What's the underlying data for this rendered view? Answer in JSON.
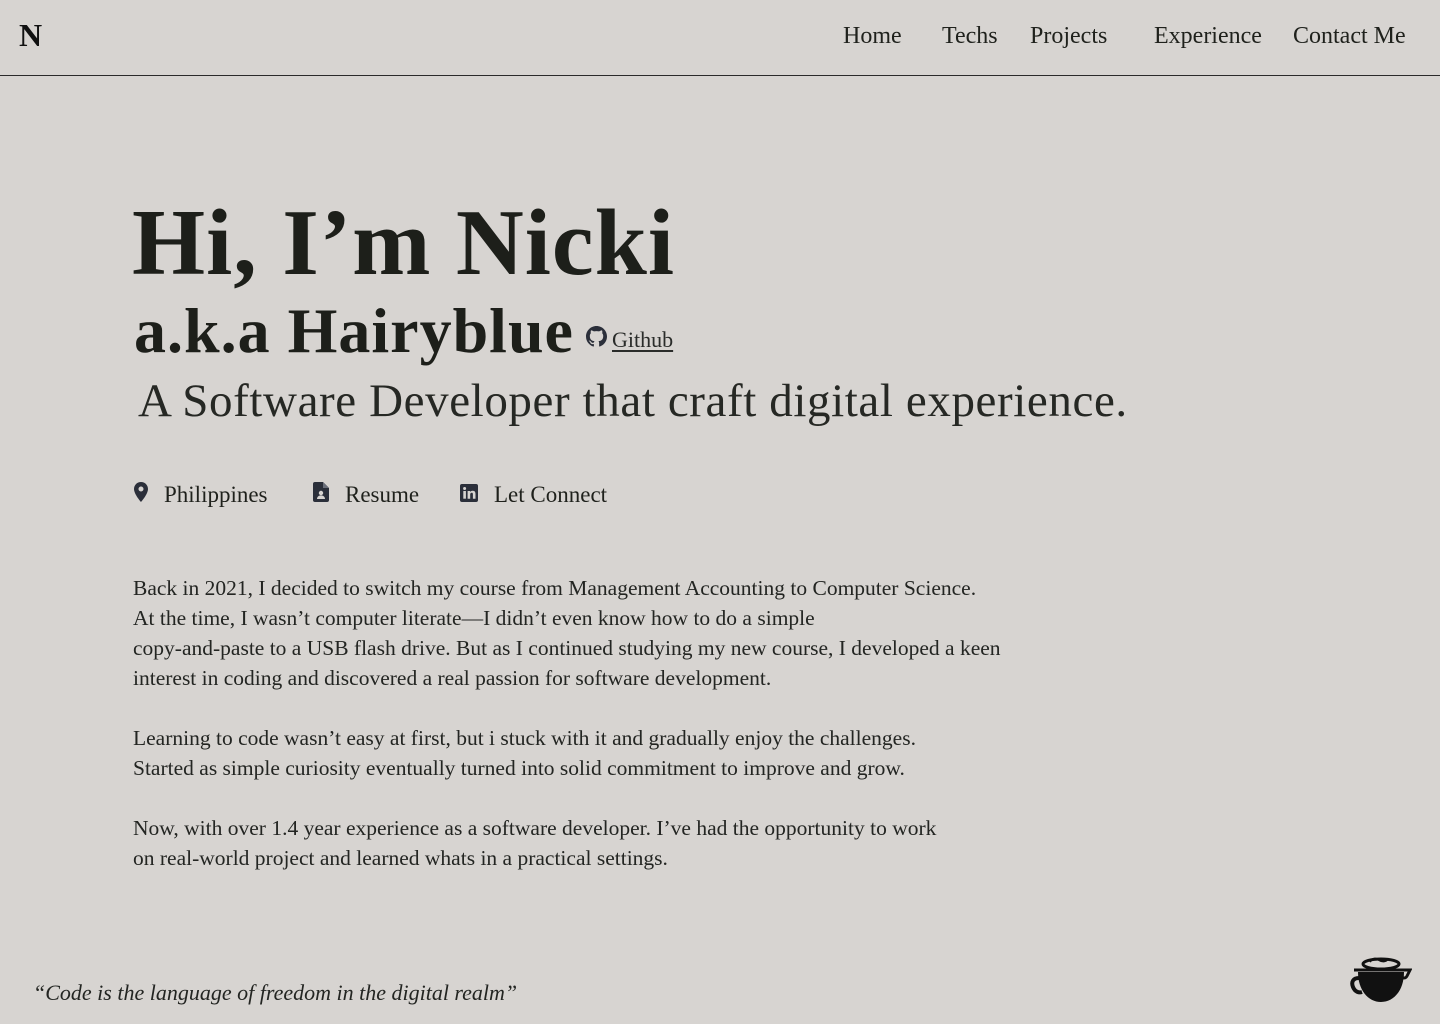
{
  "header": {
    "logo": "N",
    "nav": [
      {
        "label": "Home"
      },
      {
        "label": "Techs"
      },
      {
        "label": "Projects"
      },
      {
        "label": "Experience"
      },
      {
        "label": "Contact Me"
      }
    ]
  },
  "hero": {
    "title": "Hi, I’m Nicki",
    "aka": "a.k.a Hairyblue",
    "github_label": "Github",
    "subtitle": "A Software Developer that craft digital experience."
  },
  "meta": {
    "location": "Philippines",
    "resume": "Resume",
    "connect": "Let Connect"
  },
  "bio": {
    "p1": [
      "Back in 2021, I decided to switch my course from Management Accounting to Computer Science.",
      "At the time, I wasn’t computer literate—I didn’t even know how to do a simple",
      "copy-and-paste to a USB flash drive. But as I continued studying my new course, I developed a keen",
      "interest in coding and discovered a real passion for software development."
    ],
    "p2": [
      "Learning to code wasn’t easy at first, but i stuck with it and gradually enjoy the challenges.",
      "Started as simple curiosity eventually turned into solid commitment to improve and grow."
    ],
    "p3": [
      "Now, with over 1.4 year experience as a software developer. I’ve had the opportunity to work",
      "on real-world project and learned whats in a practical settings."
    ]
  },
  "footer": {
    "quote": "“Code is the language of freedom in the digital realm”",
    "coffee_icon": "coffee-cup-icon"
  },
  "colors": {
    "background": "#d7d4d1",
    "text": "#1f211c",
    "icon": "#2b2f3a"
  }
}
